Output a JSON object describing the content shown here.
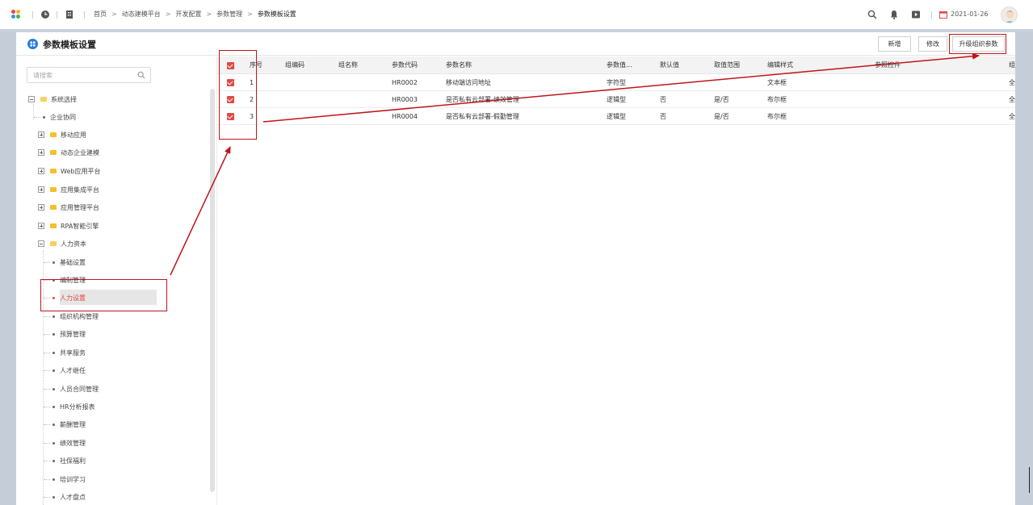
{
  "topbar": {
    "breadcrumb": [
      "首页",
      "动态建模平台",
      "开发配置",
      "参数管理",
      "参数模板设置"
    ],
    "breadcrumb_separator": ">",
    "date": "2021-01-26",
    "icons": [
      "app-logo-icon",
      "clock-icon",
      "building-icon",
      "search-icon",
      "bell-icon",
      "video-icon",
      "calendar-icon",
      "user-avatar"
    ]
  },
  "panel": {
    "title": "参数模板设置",
    "buttons": {
      "add": "新增",
      "edit": "修改",
      "upgrade": "升级组织参数"
    }
  },
  "tree": {
    "search_placeholder": "请搜索",
    "root": "系统选择",
    "items": [
      "企业协同",
      "移动应用",
      "动态企业建模",
      "Web应用平台",
      "应用集成平台",
      "应用管理平台",
      "RPA智能引擎",
      "人力资本"
    ],
    "hr_children": [
      "基础设置",
      "编制管理",
      "人力设置",
      "组织机构管理",
      "预算管理",
      "共享服务",
      "人才继任",
      "人员合同管理",
      "HR分析报表",
      "薪酬管理",
      "绩效管理",
      "社保福利",
      "培训学习",
      "人才盘点"
    ],
    "selected": "人力设置"
  },
  "grid": {
    "columns": [
      "序号",
      "组编码",
      "组名称",
      "参数代码",
      "参数名称",
      "参数值...",
      "默认值",
      "取值范围",
      "编辑样式",
      "参照控件",
      "组"
    ],
    "rows": [
      {
        "no": "1",
        "code": "HR0002",
        "name": "移动端访问地址",
        "type": "字符型",
        "default": "",
        "range": "",
        "style": "文本框",
        "last": "全"
      },
      {
        "no": "2",
        "code": "HR0003",
        "name": "是否私有云部署-绩效管理",
        "type": "逻辑型",
        "default": "否",
        "range": "是/否",
        "style": "布尔框",
        "last": "全"
      },
      {
        "no": "3",
        "code": "HR0004",
        "name": "是否私有云部署-假勤管理",
        "type": "逻辑型",
        "default": "否",
        "range": "是/否",
        "style": "布尔框",
        "last": "全"
      }
    ]
  },
  "colors": {
    "accent": "#2a7ed7",
    "selected": "#e2473f",
    "annotation": "#c0151b",
    "checkbox": "#e04b45"
  }
}
